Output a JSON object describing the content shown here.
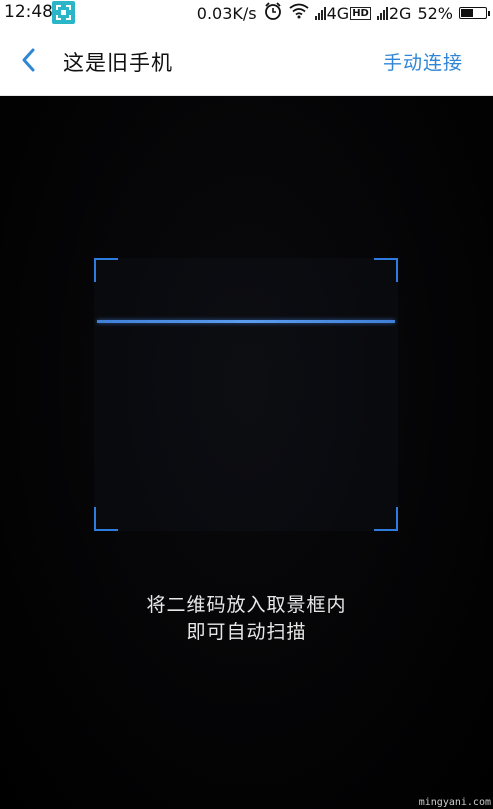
{
  "status_bar": {
    "time": "12:48",
    "network_speed": "0.03K/s",
    "network_4g": "4G",
    "hd_label": "HD",
    "network_2g": "2G",
    "battery_percent": "52%",
    "battery_level": 0.52
  },
  "header": {
    "title": "这是旧手机",
    "manual_connect_label": "手动连接"
  },
  "scanner": {
    "hint_line1": "将二维码放入取景框内",
    "hint_line2": "即可自动扫描"
  },
  "watermark": "mingyani.com",
  "colors": {
    "accent_blue": "#2f86d6",
    "scan_corner": "#2f7ce0",
    "scan_line": "#4f8fe6",
    "screenshot_icon_bg": "#2bb5c8"
  },
  "icons": {
    "back": "chevron-left-icon",
    "screenshot": "screenshot-icon",
    "alarm": "alarm-clock-icon",
    "wifi": "wifi-icon",
    "signal": "signal-icon",
    "battery": "battery-icon"
  }
}
